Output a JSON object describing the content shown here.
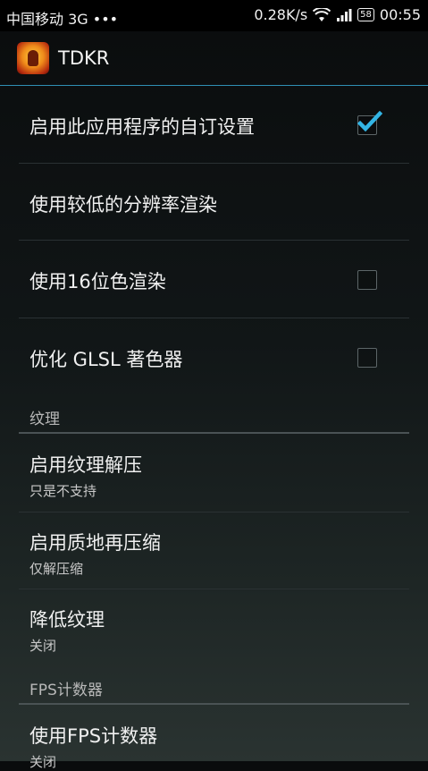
{
  "status_bar": {
    "carrier": "中国移动 3G •••",
    "speed": "0.28K/s",
    "battery": "58",
    "time": "00:55"
  },
  "action_bar": {
    "title": "TDKR"
  },
  "preferences": {
    "enable_custom": {
      "title": "启用此应用程序的自订设置",
      "checked": true
    },
    "low_resolution": {
      "title": "使用较低的分辨率渲染"
    },
    "render_16bit": {
      "title": "使用16位色渲染",
      "checked": false
    },
    "optimize_glsl": {
      "title": "优化 GLSL 著色器",
      "checked": false
    }
  },
  "category_texture": {
    "header": "纹理",
    "items": [
      {
        "title": "启用纹理解压",
        "summary": "只是不支持"
      },
      {
        "title": "启用质地再压缩",
        "summary": "仅解压缩"
      },
      {
        "title": "降低纹理",
        "summary": "关闭"
      }
    ]
  },
  "category_fps": {
    "header": "FPS计数器",
    "items": [
      {
        "title": "使用FPS计数器",
        "summary": "关闭"
      }
    ]
  },
  "colors": {
    "accent": "#33b5e5",
    "divider_accent": "#2f8fb4"
  }
}
